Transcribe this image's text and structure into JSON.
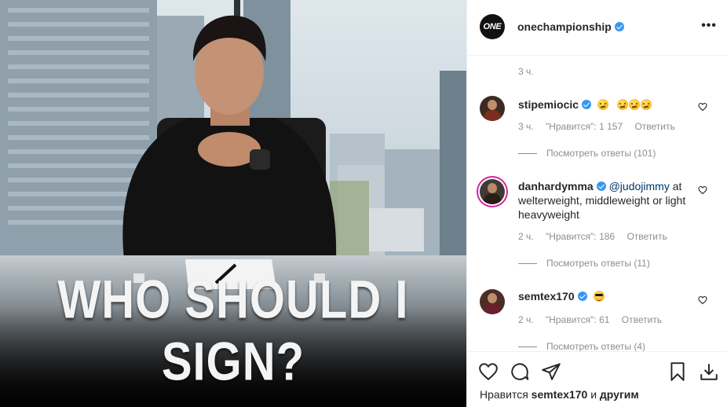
{
  "post": {
    "image_headline": "WHO SHOULD I SIGN?",
    "colors": {
      "verified": "#3897f0",
      "mention": "#00376b",
      "muted": "#8e8e8e"
    }
  },
  "header": {
    "avatar_text": "ONE",
    "username": "onechampionship",
    "more_icon": "more-horizontal-icon"
  },
  "comments_area": {
    "caption_time": "3 ч.",
    "items": [
      {
        "username": "stipemiocic",
        "text": "",
        "emoji": [
          "confused",
          "confused",
          "confused",
          "confused"
        ],
        "time": "3 ч.",
        "likes": "\"Нравится\": 1 157",
        "reply": "Ответить",
        "view_replies": "Посмотреть ответы (101)"
      },
      {
        "username": "danhardymma",
        "mention": "@judojimmy",
        "text": " at welterweight, middleweight or light heavyweight",
        "time": "2 ч.",
        "likes": "\"Нравится\": 186",
        "reply": "Ответить",
        "view_replies": "Посмотреть ответы (11)"
      },
      {
        "username": "semtex170",
        "text": "",
        "emoji": [
          "sunglasses"
        ],
        "time": "2 ч.",
        "likes": "\"Нравится\": 61",
        "reply": "Ответить",
        "view_replies": "Посмотреть ответы (4)"
      }
    ]
  },
  "actions": {
    "icons": [
      "heart-icon",
      "comment-icon",
      "share-icon",
      "bookmark-icon",
      "download-icon"
    ],
    "likes_prefix": "Нравится",
    "likes_user": "semtex170",
    "likes_conj": "и",
    "likes_others": "другим"
  }
}
